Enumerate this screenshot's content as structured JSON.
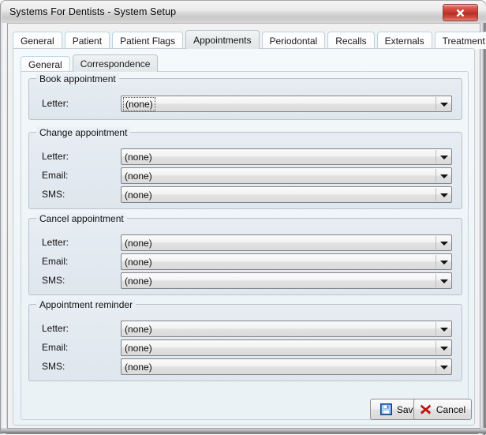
{
  "window": {
    "title": "Systems For Dentists - System Setup",
    "close_icon": "close-x-icon",
    "close_label": "x"
  },
  "outer_tabs": [
    {
      "label": "General",
      "selected": false
    },
    {
      "label": "Patient",
      "selected": false
    },
    {
      "label": "Patient Flags",
      "selected": false
    },
    {
      "label": "Appointments",
      "selected": true
    },
    {
      "label": "Periodontal",
      "selected": false
    },
    {
      "label": "Recalls",
      "selected": false
    },
    {
      "label": "Externals",
      "selected": false
    },
    {
      "label": "Treatment",
      "selected": false
    }
  ],
  "inner_tabs": [
    {
      "label": "General",
      "selected": false
    },
    {
      "label": "Correspondence",
      "selected": true
    }
  ],
  "groups": [
    {
      "title": "Book appointment",
      "fields": [
        {
          "label": "Letter:",
          "value": "(none)",
          "focused": true
        }
      ]
    },
    {
      "title": "Change appointment",
      "fields": [
        {
          "label": "Letter:",
          "value": "(none)",
          "focused": false
        },
        {
          "label": "Email:",
          "value": "(none)",
          "focused": false
        },
        {
          "label": "SMS:",
          "value": "(none)",
          "focused": false
        }
      ]
    },
    {
      "title": "Cancel appointment",
      "fields": [
        {
          "label": "Letter:",
          "value": "(none)",
          "focused": false
        },
        {
          "label": "Email:",
          "value": "(none)",
          "focused": false
        },
        {
          "label": "SMS:",
          "value": "(none)",
          "focused": false
        }
      ]
    },
    {
      "title": "Appointment reminder",
      "fields": [
        {
          "label": "Letter:",
          "value": "(none)",
          "focused": false
        },
        {
          "label": "Email:",
          "value": "(none)",
          "focused": false
        },
        {
          "label": "SMS:",
          "value": "(none)",
          "focused": false
        }
      ]
    }
  ],
  "footer": {
    "save_label": "Save",
    "save_icon": "floppy-disk-save-icon",
    "cancel_label": "Cancel",
    "cancel_icon": "red-x-cancel-icon"
  },
  "colors": {
    "close_button_red": "#c0392b",
    "save_icon_blue": "#1b5fbe",
    "cancel_icon_red": "#cc1111",
    "panel_background": "#eaf2f5",
    "groupbox_background": "#e2e9f0"
  }
}
